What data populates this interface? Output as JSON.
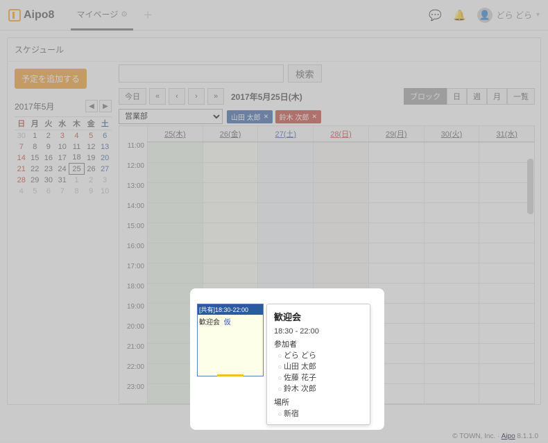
{
  "header": {
    "brand": "Aipo8",
    "tab_mypage": "マイページ",
    "user_name": "どら どら"
  },
  "panel": {
    "title": "スケジュール"
  },
  "actions": {
    "add_schedule": "予定を追加する",
    "search": "検索"
  },
  "mini_cal": {
    "title": "2017年5月",
    "dow": [
      "日",
      "月",
      "火",
      "水",
      "木",
      "金",
      "土"
    ],
    "rows": [
      [
        {
          "v": "30",
          "m": true,
          "sun": true
        },
        {
          "v": "1"
        },
        {
          "v": "2"
        },
        {
          "v": "3",
          "sun": true
        },
        {
          "v": "4",
          "sun": true
        },
        {
          "v": "5",
          "sun": true
        },
        {
          "v": "6",
          "sat": true
        }
      ],
      [
        {
          "v": "7",
          "sun": true
        },
        {
          "v": "8"
        },
        {
          "v": "9"
        },
        {
          "v": "10"
        },
        {
          "v": "11"
        },
        {
          "v": "12"
        },
        {
          "v": "13",
          "sat": true
        }
      ],
      [
        {
          "v": "14",
          "sun": true
        },
        {
          "v": "15"
        },
        {
          "v": "16"
        },
        {
          "v": "17"
        },
        {
          "v": "18"
        },
        {
          "v": "19"
        },
        {
          "v": "20",
          "sat": true
        }
      ],
      [
        {
          "v": "21",
          "sun": true
        },
        {
          "v": "22"
        },
        {
          "v": "23"
        },
        {
          "v": "24"
        },
        {
          "v": "25",
          "today": true
        },
        {
          "v": "26"
        },
        {
          "v": "27",
          "sat": true
        }
      ],
      [
        {
          "v": "28",
          "sun": true
        },
        {
          "v": "29"
        },
        {
          "v": "30"
        },
        {
          "v": "31"
        },
        {
          "v": "1",
          "m": true
        },
        {
          "v": "2",
          "m": true
        },
        {
          "v": "3",
          "m": true
        }
      ],
      [
        {
          "v": "4",
          "m": true,
          "sun": true
        },
        {
          "v": "5",
          "m": true
        },
        {
          "v": "6",
          "m": true
        },
        {
          "v": "7",
          "m": true
        },
        {
          "v": "8",
          "m": true
        },
        {
          "v": "9",
          "m": true
        },
        {
          "v": "10",
          "m": true,
          "sat": true
        }
      ]
    ]
  },
  "toolbar": {
    "today": "今日",
    "date_label": "2017年5月25日(木)",
    "views": {
      "block": "ブロック",
      "day": "日",
      "week": "週",
      "month": "月",
      "list": "一覧"
    }
  },
  "filter": {
    "group": "営業部",
    "tags": [
      {
        "label": "山田 太郎",
        "color": "blue"
      },
      {
        "label": "鈴木 次郎",
        "color": "red"
      }
    ]
  },
  "day_headers": [
    "25(木)",
    "26(金)",
    "27(土)",
    "28(日)",
    "29(月)",
    "30(火)",
    "31(水)"
  ],
  "hours": [
    "11:00",
    "12:00",
    "13:00",
    "14:00",
    "15:00",
    "16:00",
    "17:00",
    "18:00",
    "19:00",
    "20:00",
    "21:00",
    "22:00",
    "23:00"
  ],
  "event": {
    "badge": "[共有]18:30-22:00",
    "title": "歓迎会",
    "status": "仮"
  },
  "tooltip": {
    "title": "歓迎会",
    "time": "18:30 - 22:00",
    "participants_label": "参加者",
    "participants": [
      "どら どら",
      "山田 太郎",
      "佐藤 花子",
      "鈴木 次郎"
    ],
    "place_label": "場所",
    "place": "新宿"
  },
  "footer": {
    "copyright": "© TOWN, Inc.",
    "link": "Aipo",
    "version": " 8.1.1.0"
  }
}
